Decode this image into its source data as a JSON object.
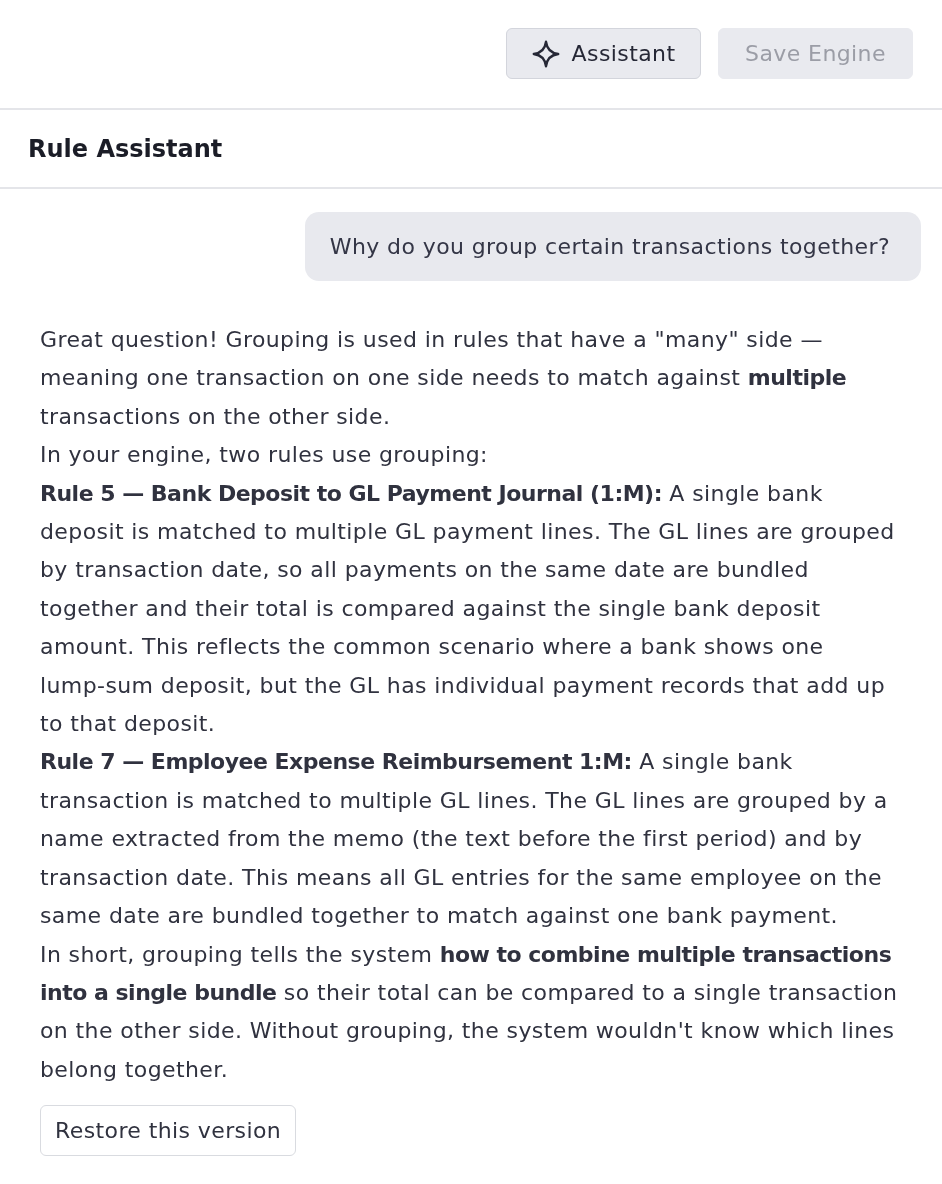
{
  "header": {
    "buttons": [
      {
        "kind": "assistant",
        "label": "Assistant",
        "disabled": false
      },
      {
        "kind": "save",
        "label": "Save Engine",
        "disabled": true
      }
    ]
  },
  "panel": {
    "title": "Rule Assistant"
  },
  "messages": [
    {
      "kind": "user",
      "text": "Why do you group certain transactions together?"
    },
    {
      "kind": "assistant",
      "paragraphs": [
        "Great question! Grouping is used in rules that have a \"many\" side — meaning one transaction on one side needs to match against **multiple** transactions on the other side.",
        "In your engine, two rules use grouping:",
        "**Rule 5 — Bank Deposit to GL Payment Journal (1:M):** A single bank deposit is matched to multiple GL payment lines. The GL lines are grouped by transaction date, so all payments on the same date are bundled together and their total is compared against the single bank deposit amount. This reflects the common scenario where a bank shows one lump‑sum deposit, but the GL has individual payment records that add up to that deposit.",
        "**Rule 7 — Employee Expense Reimbursement 1:M:** A single bank transaction is matched to multiple GL lines. The GL lines are grouped by a name extracted from the memo (the text before the first period) and by transaction date. This means all GL entries for the same employee on the same date are bundled together to match against one bank payment.",
        "In short, grouping tells the system **how to combine multiple transactions into a single bundle** so their total can be compared to a single transaction on the other side. Without grouping, the system wouldn't know which lines belong together."
      ],
      "actions": [
        {
          "label": "Restore this version"
        }
      ]
    }
  ]
}
